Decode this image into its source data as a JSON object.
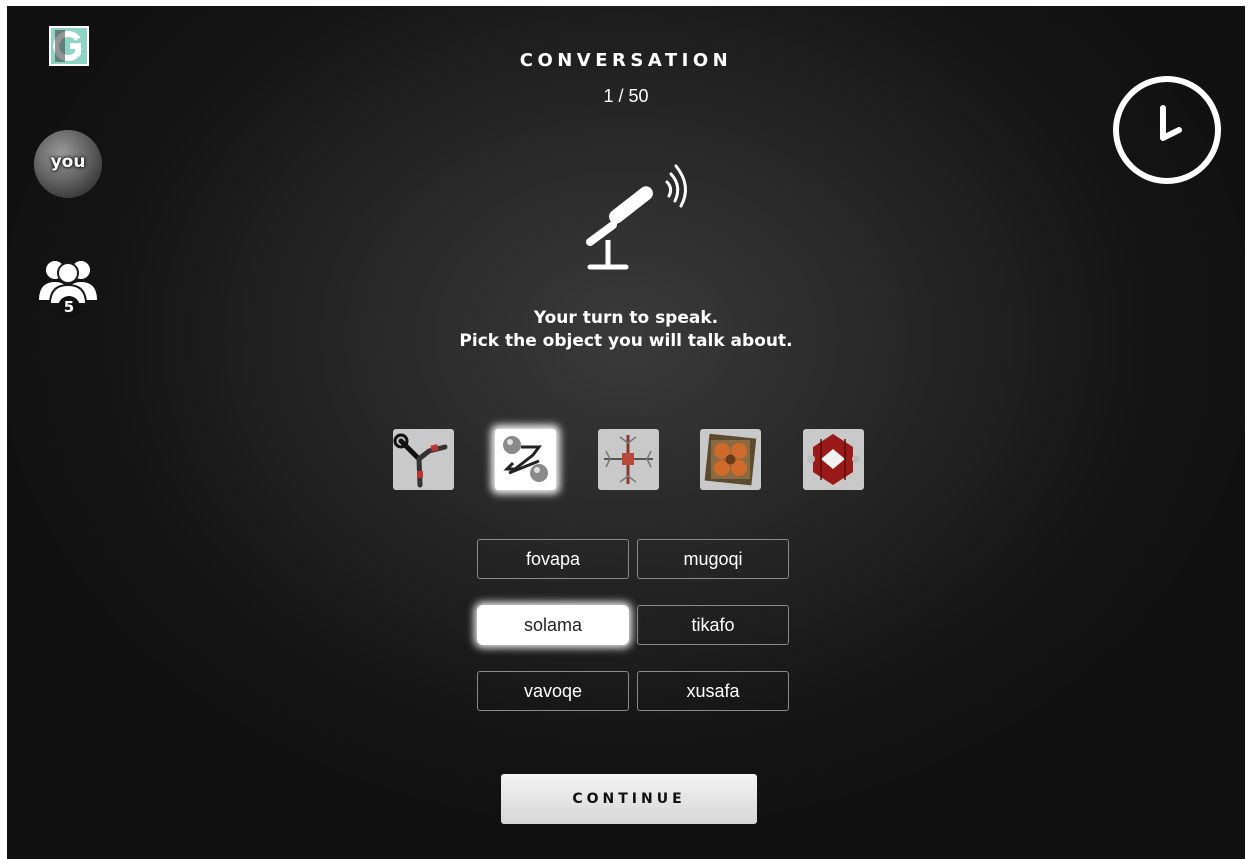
{
  "header": {
    "title": "CONVERSATION",
    "progress": "1 / 50"
  },
  "sidebar": {
    "logo_icon": "game-logo-icon",
    "avatar_label": "you",
    "players_icon": "group-icon",
    "players_count": "5"
  },
  "timer_icon": "clock-icon",
  "mic_icon": "microphone-icon",
  "instructions": {
    "line1": "Your turn to speak.",
    "line2": "Pick the object you will talk about."
  },
  "objects": [
    {
      "icon": "wrench-tool-object-icon",
      "selected": false
    },
    {
      "icon": "twin-spheres-object-icon",
      "selected": true
    },
    {
      "icon": "cross-rack-object-icon",
      "selected": false
    },
    {
      "icon": "four-petal-frame-object-icon",
      "selected": false
    },
    {
      "icon": "red-diamond-object-icon",
      "selected": false
    }
  ],
  "words": [
    {
      "label": "fovapa",
      "selected": false
    },
    {
      "label": "mugoqi",
      "selected": false
    },
    {
      "label": "solama",
      "selected": true
    },
    {
      "label": "tikafo",
      "selected": false
    },
    {
      "label": "vavoqe",
      "selected": false
    },
    {
      "label": "xusafa",
      "selected": false
    }
  ],
  "continue_label": "CONTINUE",
  "colors": {
    "background": "#1a1a1a",
    "logo_teal": "#8fd3c4",
    "text": "#ffffff",
    "button": "#e6e6e6"
  }
}
